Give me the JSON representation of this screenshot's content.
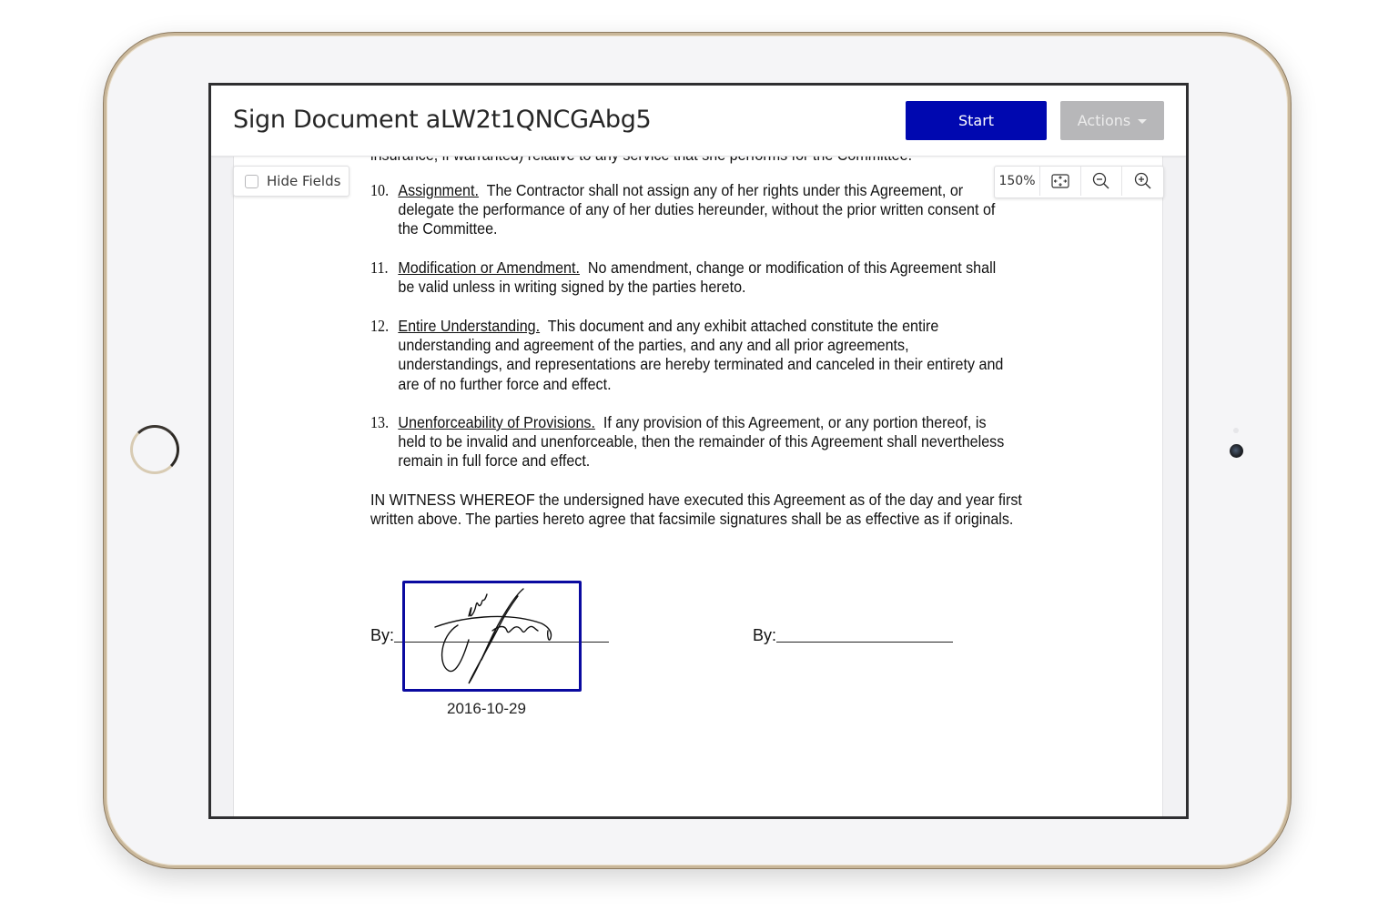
{
  "header": {
    "title": "Sign Document aLW2t1QNCGAbg5",
    "start_label": "Start",
    "actions_label": "Actions"
  },
  "toolbar": {
    "hide_fields_label": "Hide Fields",
    "hide_fields_checked": false,
    "zoom_level": "150%",
    "fit_icon": "fit-to-screen-icon",
    "zoom_out_icon": "zoom-out-icon",
    "zoom_in_icon": "zoom-in-icon"
  },
  "document": {
    "cut_line": "insurance, if warranted) relative to any service that she performs for the Committee.",
    "clauses": [
      {
        "number": "10.",
        "heading": "Assignment.",
        "text": "The Contractor shall not assign any of her rights under this Agreement, or delegate the performance of any of her duties hereunder, without the prior written consent of the Committee."
      },
      {
        "number": "11.",
        "heading": "Modification or Amendment.",
        "text": "No amendment, change or modification of this Agreement shall be valid unless in writing signed by the parties hereto."
      },
      {
        "number": "12.",
        "heading": "Entire Understanding.",
        "text": "This document and any exhibit attached constitute the entire understanding and agreement of the parties, and any and all prior agreements, understandings, and representations are hereby terminated and canceled in their entirety and are of no further force and effect."
      },
      {
        "number": "13.",
        "heading": "Unenforceability of Provisions.",
        "text": "If any provision of this Agreement, or any portion thereof, is held to be invalid and unenforceable, then the remainder of this Agreement shall nevertheless remain in full force and effect."
      }
    ],
    "witness": "IN WITNESS WHEREOF the undersigned have executed this Agreement as of the day and year first written above.  The parties hereto agree that facsimile signatures shall be as effective as if originals.",
    "signatures": [
      {
        "label": "By:",
        "signed": true,
        "date": "2016-10-29"
      },
      {
        "label": "By:",
        "signed": false
      }
    ]
  },
  "colors": {
    "start_button": "#0008b0",
    "actions_button": "#b7b7b9",
    "signature_box_border": "#0a0aa0"
  }
}
